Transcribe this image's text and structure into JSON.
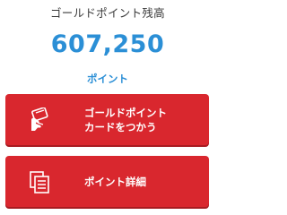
{
  "balance": {
    "label": "ゴールドポイント残高",
    "value": "607,250",
    "unit": "ポイント"
  },
  "buttons": {
    "use_card": {
      "line1": "ゴールドポイント",
      "line2": "カードをつかう",
      "icon": "hand-holding-card-icon"
    },
    "details": {
      "label": "ポイント詳細",
      "icon": "documents-icon"
    }
  },
  "colors": {
    "accent": "#2b8fd6",
    "button_bg": "#d9272e",
    "label_text": "#3a3a3a"
  }
}
